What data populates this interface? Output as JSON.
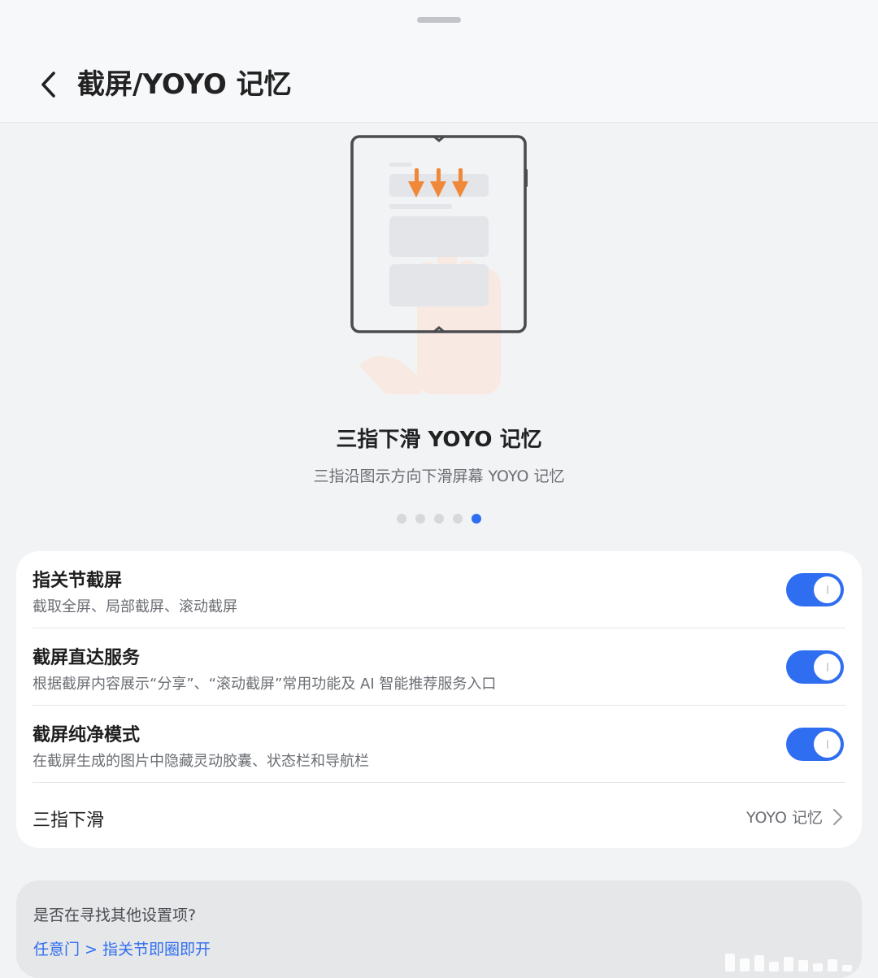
{
  "header": {
    "title": "截屏/YOYO 记忆",
    "back_icon": "chevron-left-icon"
  },
  "carousel": {
    "slide_title": "三指下滑 YOYO 记忆",
    "slide_desc": "三指沿图示方向下滑屏幕 YOYO 记忆",
    "total_slides": 5,
    "active_slide": 5,
    "accent_color": "#2f6ef0",
    "arrow_color": "#f0883a"
  },
  "settings": {
    "knuckle": {
      "title": "指关节截屏",
      "subtitle": "截取全屏、局部截屏、滚动截屏",
      "enabled": true
    },
    "direct_service": {
      "title": "截屏直达服务",
      "subtitle": "根据截屏内容展示“分享”、“滚动截屏”常用功能及 AI 智能推荐服务入口",
      "enabled": true
    },
    "pure_mode": {
      "title": "截屏纯净模式",
      "subtitle": "在截屏生成的图片中隐藏灵动胶囊、状态栏和导航栏",
      "enabled": true
    },
    "three_finger": {
      "title": "三指下滑",
      "value": "YOYO 记忆"
    }
  },
  "help": {
    "question": "是否在寻找其他设置项?",
    "link": "任意门 > 指关节即圈即开"
  }
}
